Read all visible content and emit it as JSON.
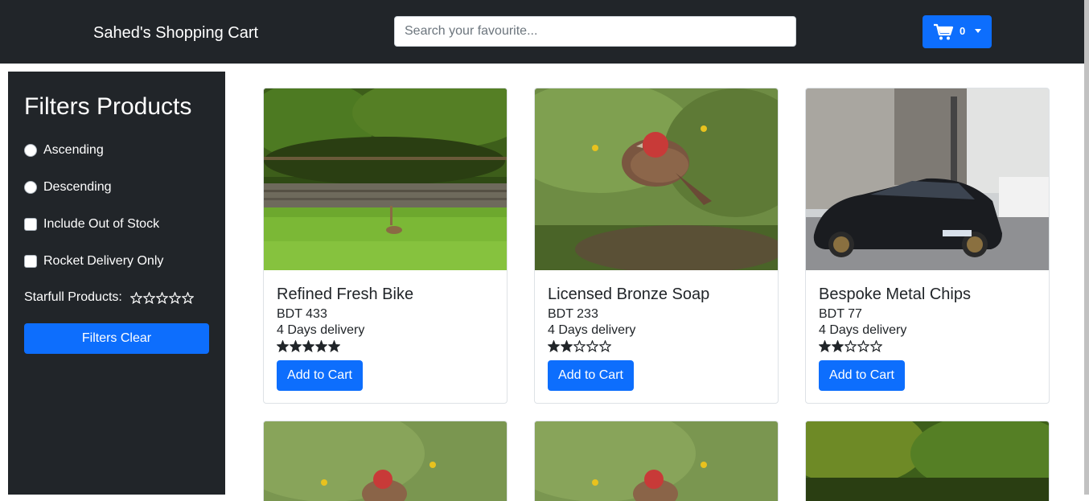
{
  "navbar": {
    "brand": "Sahed's Shopping Cart",
    "search_placeholder": "Search your favourite...",
    "cart_count": "0"
  },
  "sidebar": {
    "title": "Filters Products",
    "ascending": "Ascending",
    "descending": "Descending",
    "include_out_of_stock": "Include Out of Stock",
    "rocket_delivery": "Rocket Delivery Only",
    "rating_label": "Starfull Products:",
    "rating_value": 0,
    "clear_button": "Filters Clear"
  },
  "products": [
    {
      "name": "Refined Fresh Bike",
      "price": "BDT 433",
      "delivery": "4 Days delivery",
      "rating": 5,
      "button": "Add to Cart",
      "image": "rabbit-in-grass"
    },
    {
      "name": "Licensed Bronze Soap",
      "price": "BDT 233",
      "delivery": "4 Days delivery",
      "rating": 2,
      "button": "Add to Cart",
      "image": "red-headed-bird"
    },
    {
      "name": "Bespoke Metal Chips",
      "price": "BDT 77",
      "delivery": "4 Days delivery",
      "rating": 2,
      "button": "Add to Cart",
      "image": "black-sports-car"
    }
  ],
  "colors": {
    "navbar": "#212529",
    "primary": "#0d6efd"
  }
}
